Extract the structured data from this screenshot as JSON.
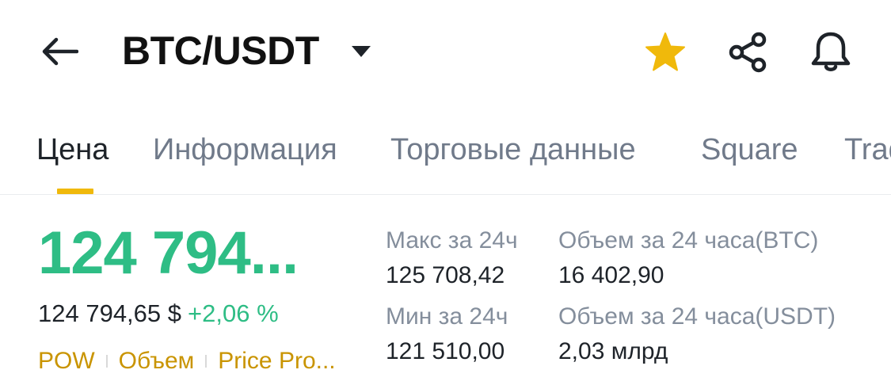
{
  "header": {
    "pair": "BTC/USDT",
    "favorite_color": "#f0b90b"
  },
  "tabs": [
    {
      "label": "Цена",
      "active": true
    },
    {
      "label": "Информация",
      "active": false
    },
    {
      "label": "Торговые данные",
      "active": false
    },
    {
      "label": "Square",
      "active": false
    },
    {
      "label": "Trading",
      "active": false
    }
  ],
  "price": {
    "last": "124 794...",
    "usd": "124 794,65 $",
    "change": "+2,06 %",
    "color": "#2ebd85"
  },
  "tags": [
    "POW",
    "Объем",
    "Price Pro..."
  ],
  "stats": {
    "high_label": "Макс за 24ч",
    "high_value": "125 708,42",
    "vol_btc_label": "Объем за 24 часа(BTC)",
    "vol_btc_value": "16 402,90",
    "low_label": "Мин за 24ч",
    "low_value": "121 510,00",
    "vol_usdt_label": "Объем за 24 часа(USDT)",
    "vol_usdt_value": "2,03 млрд"
  }
}
